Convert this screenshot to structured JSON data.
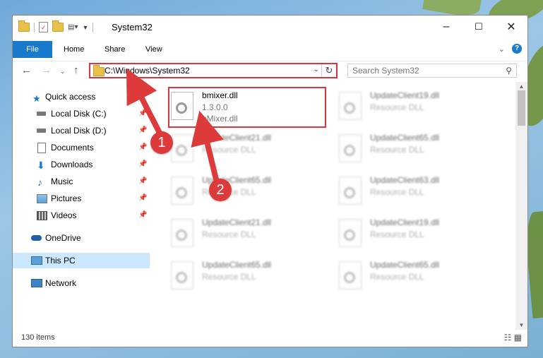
{
  "window": {
    "title": "System32",
    "controls": [
      "–",
      "☐",
      "✕"
    ]
  },
  "ribbon": {
    "tabs": [
      "File",
      "Home",
      "Share",
      "View"
    ],
    "help_label": "?"
  },
  "address": {
    "path": "C:\\Windows\\System32",
    "search_placeholder": "Search System32"
  },
  "nav": {
    "items": [
      {
        "label": "Quick access",
        "icon": "star-icon",
        "pinned": false
      },
      {
        "label": "Local Disk (C:)",
        "icon": "drive-icon",
        "pinned": true
      },
      {
        "label": "Local Disk (D:)",
        "icon": "drive-icon",
        "pinned": true
      },
      {
        "label": "Documents",
        "icon": "documents-icon",
        "pinned": true
      },
      {
        "label": "Downloads",
        "icon": "download-icon",
        "pinned": true
      },
      {
        "label": "Music",
        "icon": "music-icon",
        "pinned": true
      },
      {
        "label": "Pictures",
        "icon": "pictures-icon",
        "pinned": true
      },
      {
        "label": "Videos",
        "icon": "videos-icon",
        "pinned": true
      },
      {
        "label": "OneDrive",
        "icon": "cloud-icon",
        "pinned": false
      },
      {
        "label": "This PC",
        "icon": "computer-icon",
        "pinned": false,
        "selected": true
      },
      {
        "label": "Network",
        "icon": "network-icon",
        "pinned": false
      }
    ]
  },
  "files": {
    "highlighted": {
      "name": "bmixer.dll",
      "version": "1.3.0.0",
      "description": "bMixer.dll"
    },
    "blurred": [
      {
        "name": "UpdateClient19.dll",
        "description": "Resource DLL"
      },
      {
        "name": "UpdateClient21.dll",
        "description": "Resource DLL"
      },
      {
        "name": "UpdateClient65.dll",
        "description": "Resource DLL"
      },
      {
        "name": "UpdateClient65.dll",
        "description": "Resource DLL"
      },
      {
        "name": "UpdateClient63.dll",
        "description": "Resource DLL"
      },
      {
        "name": "UpdateClient21.dll",
        "description": "Resource DLL"
      },
      {
        "name": "UpdateClient19.dll",
        "description": "Resource DLL"
      },
      {
        "name": "UpdateClient65.dll",
        "description": "Resource DLL"
      },
      {
        "name": "UpdateClient65.dll",
        "description": "Resource DLL"
      }
    ]
  },
  "status": {
    "item_count": "130 items"
  },
  "callouts": {
    "one": "1",
    "two": "2",
    "color": "#dd3b3b"
  },
  "colors": {
    "accent": "#1979ca",
    "selection": "#cce8ff",
    "highlight_border": "#d9363e"
  }
}
